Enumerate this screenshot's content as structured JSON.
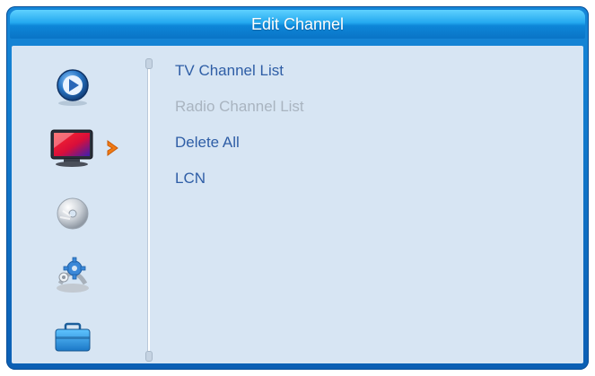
{
  "window": {
    "title": "Edit Channel"
  },
  "sidebar": {
    "icons": [
      {
        "name": "play-icon"
      },
      {
        "name": "tv-icon",
        "selected": true
      },
      {
        "name": "disc-icon"
      },
      {
        "name": "settings-gear-icon"
      },
      {
        "name": "toolbox-icon"
      }
    ],
    "selection_indicator": "chevron-right-icon"
  },
  "menu": {
    "items": [
      {
        "label": "TV Channel List",
        "enabled": true
      },
      {
        "label": "Radio Channel List",
        "enabled": false
      },
      {
        "label": "Delete All",
        "enabled": true
      },
      {
        "label": "LCN",
        "enabled": true
      }
    ]
  },
  "colors": {
    "title_bar": "#23a8ef",
    "frame": "#0b5fb4",
    "panel": "#d7e5f3",
    "menu_text": "#2f5ea6",
    "menu_text_disabled": "#a9b4c0",
    "selection_arrow": "#f07a14"
  }
}
